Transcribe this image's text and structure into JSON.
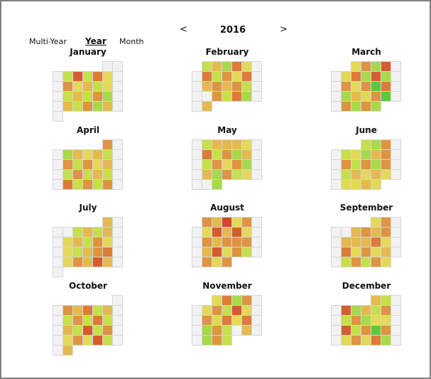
{
  "header": {
    "prev_label": "<",
    "year": "2016",
    "next_label": ">"
  },
  "views": [
    {
      "label": "Multi-Year",
      "active": false
    },
    {
      "label": "Year",
      "active": true
    },
    {
      "label": "Month",
      "active": false
    }
  ],
  "palette": {
    "g": "#f2f2f2",
    "G1": "#a7d94a",
    "G2": "#c6df4a",
    "Gb": "#5cc93c",
    "Y": "#e4d858",
    "Y2": "#e4b94e",
    "O": "#de9440",
    "O2": "#dc7c38",
    "R": "#d65b30",
    "RR": "#d4442e"
  },
  "months": [
    {
      "name": "January",
      "weeks": [
        [
          null,
          null,
          null,
          null,
          null,
          "g",
          "g"
        ],
        [
          "g",
          "G2",
          "R",
          "G2",
          "O2",
          "Y",
          "g"
        ],
        [
          "g",
          "O",
          "Y",
          "Y2",
          "G2",
          "Y",
          "g"
        ],
        [
          "g",
          "G2",
          "Y2",
          "G2",
          "O",
          "G1",
          "g"
        ],
        [
          "g",
          "Y2",
          "G2",
          "O",
          "G1",
          "Y2",
          "g"
        ],
        [
          "g",
          null,
          null,
          null,
          null,
          null,
          null
        ]
      ]
    },
    {
      "name": "February",
      "weeks": [
        [
          null,
          "G2",
          "Y2",
          "G1",
          "O2",
          "Y",
          "g"
        ],
        [
          "g",
          "O2",
          "G2",
          "O",
          "Y",
          "O2",
          "g"
        ],
        [
          "g",
          "Y2",
          "O",
          "Y2",
          "O",
          "G2",
          "g"
        ],
        [
          "g",
          "g",
          "O",
          "G2",
          "O2",
          "G1",
          "g"
        ],
        [
          "g",
          "Y2",
          null,
          null,
          null,
          null,
          null
        ]
      ]
    },
    {
      "name": "March",
      "weeks": [
        [
          null,
          null,
          "Y",
          "O",
          "G1",
          "R",
          "g"
        ],
        [
          "g",
          "Y",
          "O2",
          "G1",
          "R",
          "G1",
          "g"
        ],
        [
          "g",
          "O",
          "Y",
          "O",
          "Gb",
          "O2",
          "g"
        ],
        [
          "g",
          "G1",
          "Y2",
          "Y",
          "O",
          "Gb",
          "g"
        ],
        [
          "g",
          "O",
          "G1",
          "O",
          "G1",
          null,
          null
        ]
      ]
    },
    {
      "name": "April",
      "weeks": [
        [
          null,
          null,
          null,
          null,
          null,
          "O",
          "g"
        ],
        [
          "g",
          "G1",
          "Y2",
          "Y",
          "Y2",
          "G2",
          "g"
        ],
        [
          "g",
          "O",
          "G2",
          "O",
          "Y",
          "Y2",
          "g"
        ],
        [
          "g",
          "G2",
          "O",
          "G2",
          "Y2",
          "G2",
          "g"
        ],
        [
          "g",
          "O2",
          "G2",
          "O",
          "G2",
          "O",
          "g"
        ]
      ]
    },
    {
      "name": "May",
      "weeks": [
        [
          "g",
          "G2",
          "Y2",
          "Y2",
          "Y2",
          "Y",
          "g"
        ],
        [
          "g",
          "O2",
          "G2",
          "O",
          "G1",
          "Y2",
          "g"
        ],
        [
          "g",
          "G2",
          "O",
          "Y",
          "O",
          "G1",
          "g"
        ],
        [
          "g",
          "Y2",
          "G1",
          "O",
          "G2",
          "Y",
          "g"
        ],
        [
          "g",
          "g",
          "G1",
          null,
          null,
          null,
          null
        ]
      ]
    },
    {
      "name": "June",
      "weeks": [
        [
          null,
          null,
          null,
          "G2",
          "G1",
          "O",
          "g"
        ],
        [
          "g",
          "G2",
          "Y",
          "G1",
          "Y2",
          "O",
          "g"
        ],
        [
          "g",
          "O",
          "G2",
          "O",
          "G1",
          "O",
          "g"
        ],
        [
          "g",
          "G2",
          "Y2",
          "Y",
          "Y2",
          "Y",
          "g"
        ],
        [
          "g",
          "Y",
          "Y",
          "Y2",
          "Y",
          null,
          null
        ]
      ]
    },
    {
      "name": "July",
      "weeks": [
        [
          null,
          null,
          null,
          null,
          null,
          "Y2",
          "g"
        ],
        [
          "g",
          "g",
          "G2",
          "Y2",
          "G2",
          "Y2",
          "g"
        ],
        [
          "g",
          "Y",
          "Y2",
          "G2",
          "O",
          "Y",
          "g"
        ],
        [
          "g",
          "Y",
          "G2",
          "Y2",
          "O",
          "O2",
          "g"
        ],
        [
          "g",
          "Y",
          "O",
          "Y2",
          "R",
          "Y2",
          "g"
        ],
        [
          "g",
          null,
          null,
          null,
          null,
          null,
          null
        ]
      ]
    },
    {
      "name": "August",
      "weeks": [
        [
          null,
          "O",
          "Y2",
          "RR",
          "Y",
          "O",
          "g"
        ],
        [
          "g",
          "Y",
          "R",
          "Y2",
          "R",
          "Y",
          "g"
        ],
        [
          "g",
          "O",
          "Y2",
          "O",
          "O",
          "O",
          "g"
        ],
        [
          "g",
          "Y2",
          "R",
          "Y",
          "O",
          "G2",
          "g"
        ],
        [
          "g",
          "O",
          "Y",
          "O",
          null,
          null,
          null
        ]
      ]
    },
    {
      "name": "September",
      "weeks": [
        [
          null,
          null,
          null,
          null,
          "Y",
          "O",
          "g"
        ],
        [
          "g",
          "g",
          "Y2",
          "O",
          "Y2",
          "O",
          "g"
        ],
        [
          "g",
          "Y2",
          "Y2",
          "Y2",
          "O2",
          "Y",
          "g"
        ],
        [
          "g",
          "O2",
          "Y",
          "O",
          "Y",
          "Y2",
          "g"
        ],
        [
          "g",
          "G2",
          "O",
          "G2",
          "O",
          "Y",
          null
        ]
      ]
    },
    {
      "name": "October",
      "weeks": [
        [
          null,
          null,
          null,
          null,
          null,
          null,
          "g"
        ],
        [
          "g",
          "O",
          "Y2",
          "O2",
          "G2",
          "Y2",
          "g"
        ],
        [
          "g",
          "G2",
          "O",
          "G2",
          "O2",
          "G2",
          "g"
        ],
        [
          "g",
          "Y2",
          "G2",
          "R",
          "G2",
          "O",
          "g"
        ],
        [
          "g",
          "Y",
          "O",
          "Y",
          "R",
          "G2",
          "g"
        ],
        [
          "g",
          "Y2",
          null,
          null,
          null,
          null,
          null
        ]
      ]
    },
    {
      "name": "November",
      "weeks": [
        [
          null,
          null,
          "Y",
          "O2",
          "G1",
          "O",
          "g"
        ],
        [
          "g",
          "Y",
          "O",
          "G2",
          "R",
          "Y",
          "g"
        ],
        [
          "g",
          "O",
          "Y",
          "O2",
          "Y",
          "O2",
          "g"
        ],
        [
          "g",
          "G1",
          "O",
          "G2",
          "g",
          "Y2",
          "g"
        ],
        [
          "g",
          "G1",
          "O",
          "G2",
          null,
          null,
          null
        ]
      ]
    },
    {
      "name": "December",
      "weeks": [
        [
          null,
          null,
          null,
          null,
          "Y2",
          "G2",
          "g"
        ],
        [
          "g",
          "R",
          "G1",
          "Y2",
          "G2",
          "O",
          "g"
        ],
        [
          "g",
          "G2",
          "O",
          "G1",
          "Y",
          "Y",
          "g"
        ],
        [
          "g",
          "R",
          "G2",
          "O",
          "Gb",
          "O",
          "g"
        ],
        [
          "g",
          "Y",
          "O",
          "Y",
          "O2",
          "G1",
          "g"
        ]
      ]
    }
  ]
}
